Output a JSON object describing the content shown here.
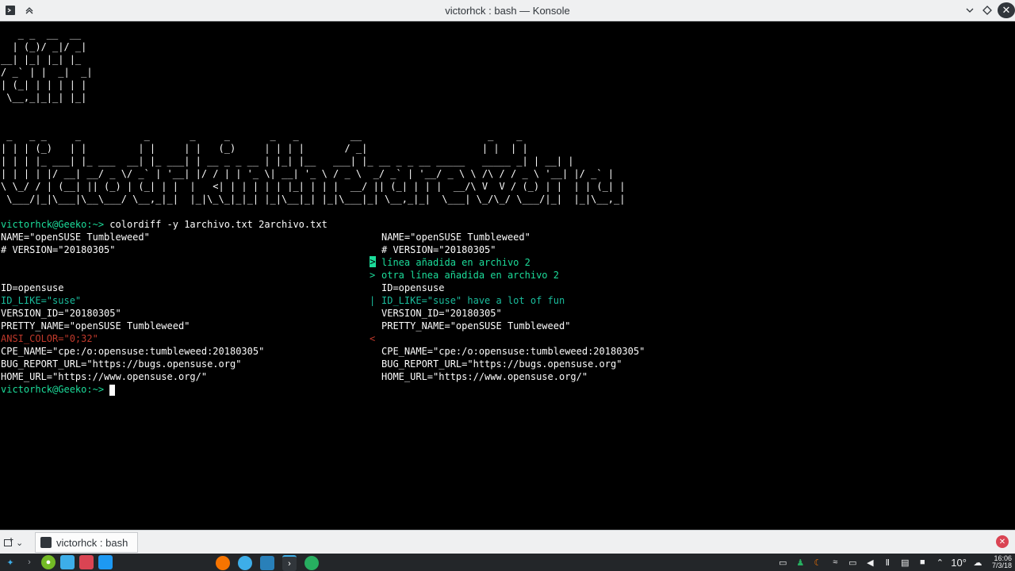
{
  "window": {
    "title": "victorhck : bash — Konsole"
  },
  "terminal": {
    "lines": [
      {
        "text": "   _ _  __  __",
        "color": "white"
      },
      {
        "text": "  | (_)/ _|/ _|",
        "color": "white"
      },
      {
        "text": "__| |_| |_| |_",
        "color": "white"
      },
      {
        "text": "/ _` | |  _|  _|",
        "color": "white"
      },
      {
        "text": "| (_| | | | | |",
        "color": "white"
      },
      {
        "text": " \\__,_|_|_| |_|",
        "color": "white"
      },
      {
        "text": "",
        "color": "white"
      },
      {
        "text": "",
        "color": "white"
      },
      {
        "text": " _   _ _     _           _       _     _       _   _         __                      _    _",
        "color": "white"
      },
      {
        "text": "| | | (_)   | |         | |     | |   (_)     | | | |       / _|                    | |  | |",
        "color": "white"
      },
      {
        "text": "| | | |_ ___| |_ ___  __| |_ ___| | __ _ _ __ | |_| |__   ___| |_ __ _ _ __ _____   _____ _| | __| |",
        "color": "white"
      },
      {
        "text": "| | | | |/ __| __/ _ \\/ _` | '__| |/ / | | '_ \\| __| '_ \\ / _ \\  _/ _` | '__/ _ \\ \\ /\\ / / _ \\ '__| |/ _` |",
        "color": "white"
      },
      {
        "text": "\\ \\_/ / | (__| || (_) | (_| | |  |   <| | | | | | |_| | | |  __/ || (_| | | |  __/\\ V  V / (_) | |  | | (_| |",
        "color": "white"
      },
      {
        "text": " \\___/|_|\\___|\\__\\___/ \\__,_|_|  |_|\\_\\_|_|_| |_|\\__|_| |_|\\___|_| \\__,_|_|  \\___| \\_/\\_/ \\___/|_|  |_|\\__,_|",
        "color": "white"
      },
      {
        "text": "",
        "color": "white"
      },
      {
        "prompt": "victorhck@Geeko:~>",
        "text": " colordiff -y 1archivo.txt 2archivo.txt"
      },
      {
        "left": "NAME=\"openSUSE Tumbleweed\"",
        "marker": "",
        "right": "NAME=\"openSUSE Tumbleweed\"",
        "lcolor": "white",
        "mcolor": "white",
        "rcolor": "white"
      },
      {
        "left": "# VERSION=\"20180305\"",
        "marker": "",
        "right": "# VERSION=\"20180305\"",
        "lcolor": "white",
        "mcolor": "white",
        "rcolor": "white"
      },
      {
        "left": "",
        "marker": ">",
        "right": "línea añadida en archivo 2",
        "lcolor": "white",
        "mcolor": "green-block",
        "rcolor": "green"
      },
      {
        "left": "",
        "marker": ">",
        "right": "otra línea añadida en archivo 2",
        "lcolor": "white",
        "mcolor": "green",
        "rcolor": "green"
      },
      {
        "left": "ID=opensuse",
        "marker": "",
        "right": "ID=opensuse",
        "lcolor": "white",
        "mcolor": "white",
        "rcolor": "white"
      },
      {
        "left": "ID_LIKE=\"suse\"",
        "marker": "|",
        "right": "ID_LIKE=\"suse\" have a lot of fun",
        "lcolor": "cyan",
        "mcolor": "cyan",
        "rcolor": "cyan"
      },
      {
        "left": "VERSION_ID=\"20180305\"",
        "marker": "",
        "right": "VERSION_ID=\"20180305\"",
        "lcolor": "white",
        "mcolor": "white",
        "rcolor": "white"
      },
      {
        "left": "PRETTY_NAME=\"openSUSE Tumbleweed\"",
        "marker": "",
        "right": "PRETTY_NAME=\"openSUSE Tumbleweed\"",
        "lcolor": "white",
        "mcolor": "white",
        "rcolor": "white"
      },
      {
        "left": "ANSI_COLOR=\"0;32\"",
        "marker": "<",
        "right": "",
        "lcolor": "red",
        "mcolor": "red",
        "rcolor": "white"
      },
      {
        "left": "CPE_NAME=\"cpe:/o:opensuse:tumbleweed:20180305\"",
        "marker": "",
        "right": "CPE_NAME=\"cpe:/o:opensuse:tumbleweed:20180305\"",
        "lcolor": "white",
        "mcolor": "white",
        "rcolor": "white"
      },
      {
        "left": "BUG_REPORT_URL=\"https://bugs.opensuse.org\"",
        "marker": "",
        "right": "BUG_REPORT_URL=\"https://bugs.opensuse.org\"",
        "lcolor": "white",
        "mcolor": "white",
        "rcolor": "white"
      },
      {
        "left": "HOME_URL=\"https://www.opensuse.org/\"",
        "marker": "",
        "right": "HOME_URL=\"https://www.opensuse.org/\"",
        "lcolor": "white",
        "mcolor": "white",
        "rcolor": "white"
      },
      {
        "prompt": "victorhck@Geeko:~>",
        "text": " ",
        "cursor": true
      }
    ]
  },
  "tabbar": {
    "tab_label": "victorhck : bash",
    "new_tab_icon": "new-tab-icon"
  },
  "taskbar": {
    "temperature": "10°",
    "time": "16:06",
    "date": "7/3/18"
  },
  "colors": {
    "green": "#1cdc9a",
    "cyan": "#1abc9c",
    "red": "#c0392b",
    "white": "#fcfcfc",
    "window_bg": "#eff0f1",
    "taskbar_bg": "#232629"
  }
}
